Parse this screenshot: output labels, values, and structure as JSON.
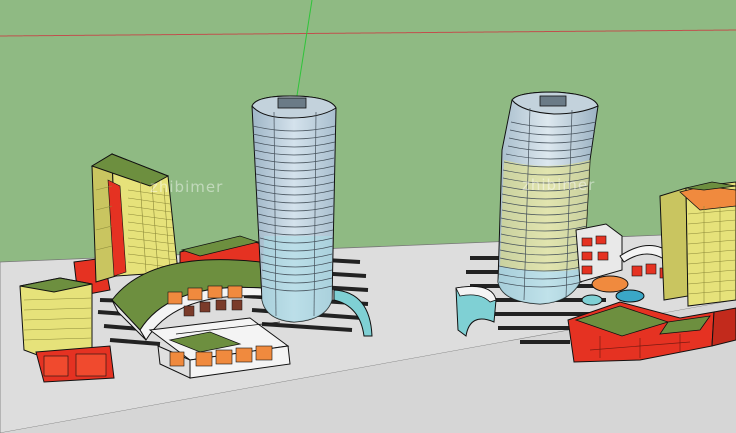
{
  "viewport": {
    "background_color": "#8fba83",
    "ground_color": "#dddddd",
    "axis_colors": {
      "red": "#c0504d",
      "green": "#2fc43a",
      "blue": "#3a5bd9"
    }
  },
  "watermarks": {
    "left": "zhibimer",
    "right": "zhibimer"
  },
  "palette": {
    "glass": "#b4c8d8",
    "glass_light": "#d6e4ee",
    "teal": "#7fd0d4",
    "yellow": "#e6e27a",
    "yellow_dark": "#c9c560",
    "red": "#e53222",
    "orange": "#f08a3e",
    "roof_green": "#6d8f3f",
    "white": "#f4f4f4"
  }
}
